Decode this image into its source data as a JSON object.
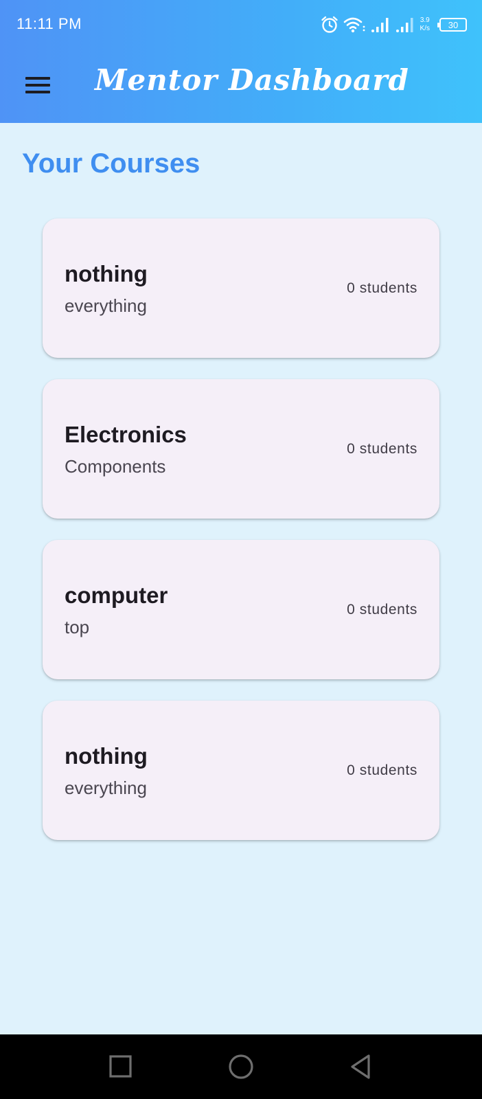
{
  "status_bar": {
    "time": "11:11 PM",
    "net_speed_value": "3.9",
    "net_speed_unit": "K/s",
    "battery": "30",
    "icons": [
      "alarm-icon",
      "wifi-icon",
      "signal-icon",
      "signal-icon",
      "battery-icon"
    ]
  },
  "app_bar": {
    "title": "Mentor Dashboard",
    "menu_icon": "hamburger-menu-icon",
    "colors": {
      "gradient_start": "#4f93f6",
      "gradient_end": "#3fc2fb"
    }
  },
  "main": {
    "section_title": "Your Courses",
    "courses": [
      {
        "name": "nothing",
        "description": "everything",
        "students": "0 students"
      },
      {
        "name": "Electronics",
        "description": "Components",
        "students": "0 students"
      },
      {
        "name": "computer",
        "description": "top",
        "students": "0 students"
      },
      {
        "name": "nothing",
        "description": "everything",
        "students": "0 students"
      }
    ]
  },
  "nav_bar": {
    "buttons": [
      "recents-square-icon",
      "home-circle-icon",
      "back-triangle-icon"
    ]
  },
  "colors": {
    "background": "#dff2fc",
    "card": "#f5eff8",
    "accent": "#3f8ef0"
  }
}
